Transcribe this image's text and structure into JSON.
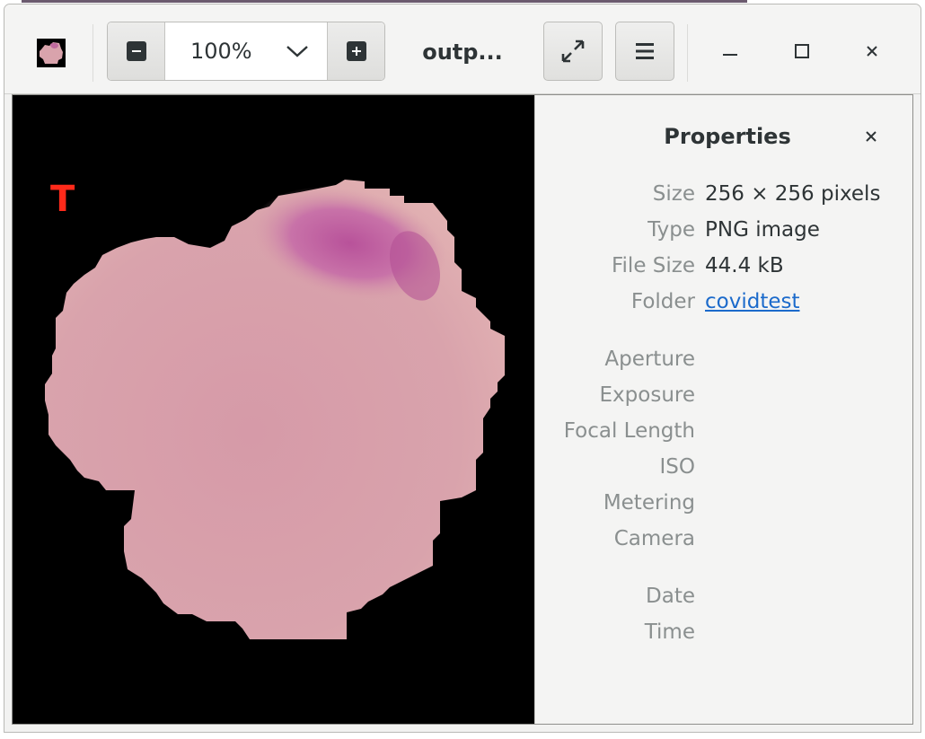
{
  "window": {
    "title": "outp...",
    "zoom": {
      "value": "100%",
      "options_selected": "100%"
    },
    "icons": {
      "zoom_out": "zoom-out-icon",
      "zoom_in": "zoom-in-icon",
      "zoom_dropdown": "chevron-down-icon",
      "fullscreen": "fullscreen-icon",
      "menu": "hamburger-menu-icon",
      "minimize": "minimize-icon",
      "maximize": "maximize-icon",
      "close": "close-icon"
    }
  },
  "image": {
    "overlay_letter": "T",
    "colors": {
      "background": "#000000",
      "cell_body": "#d9a3ac",
      "cell_stain": "#b8529a",
      "overlay_letter": "#ff2a1a"
    }
  },
  "properties": {
    "title": "Properties",
    "close_icon": "close-icon",
    "rows": [
      {
        "label": "Size",
        "value": "256 × 256 pixels"
      },
      {
        "label": "Type",
        "value": "PNG image"
      },
      {
        "label": "File Size",
        "value": "44.4 kB"
      },
      {
        "label": "Folder",
        "value": "covidtest",
        "link": true
      }
    ],
    "exif_rows": [
      {
        "label": "Aperture",
        "value": ""
      },
      {
        "label": "Exposure",
        "value": ""
      },
      {
        "label": "Focal Length",
        "value": ""
      },
      {
        "label": "ISO",
        "value": ""
      },
      {
        "label": "Metering",
        "value": ""
      },
      {
        "label": "Camera",
        "value": ""
      }
    ],
    "date_rows": [
      {
        "label": "Date",
        "value": ""
      },
      {
        "label": "Time",
        "value": ""
      }
    ]
  },
  "colors": {
    "accent_link": "#1b6acb",
    "label_gray": "#8a8f8f",
    "text_dark": "#2e3436"
  }
}
